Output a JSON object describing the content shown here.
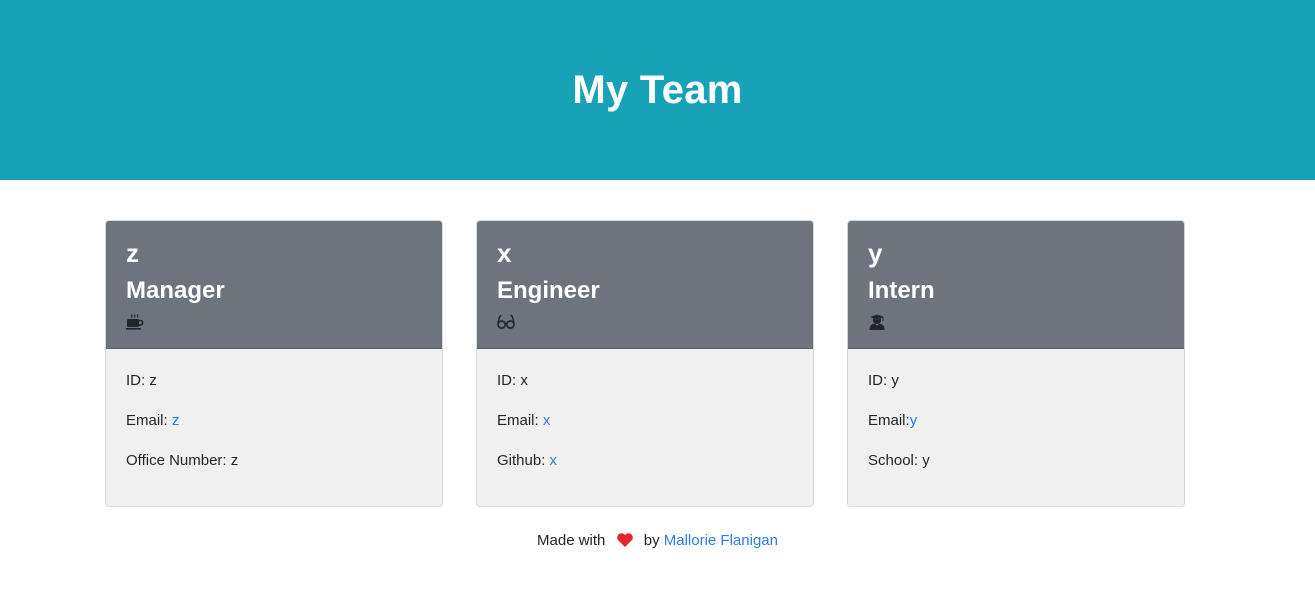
{
  "header": {
    "title": "My Team",
    "background_color": "#17a2b8"
  },
  "cards": [
    {
      "name": "z",
      "role": "Manager",
      "icon": "coffee-icon",
      "id_label": "ID: ",
      "id_value": "z",
      "email_label": "Email: ",
      "email_value": "z",
      "extra_label": "Office Number: ",
      "extra_value": "z"
    },
    {
      "name": "x",
      "role": "Engineer",
      "icon": "glasses-icon",
      "id_label": "ID: ",
      "id_value": "x",
      "email_label": "Email: ",
      "email_value": "x",
      "extra_label": "Github: ",
      "extra_value": "x"
    },
    {
      "name": "y",
      "role": "Intern",
      "icon": "user-graduate-icon",
      "id_label": "ID: ",
      "id_value": "y",
      "email_label": "Email:",
      "email_value": "y",
      "extra_label": "School: ",
      "extra_value": "y"
    }
  ],
  "footer": {
    "made_with": "Made with",
    "heart_icon": "heart-icon",
    "by": "by",
    "author": "Mallorie Flanigan",
    "link_color": "#2f7de1",
    "heart_color": "#e3262b"
  }
}
